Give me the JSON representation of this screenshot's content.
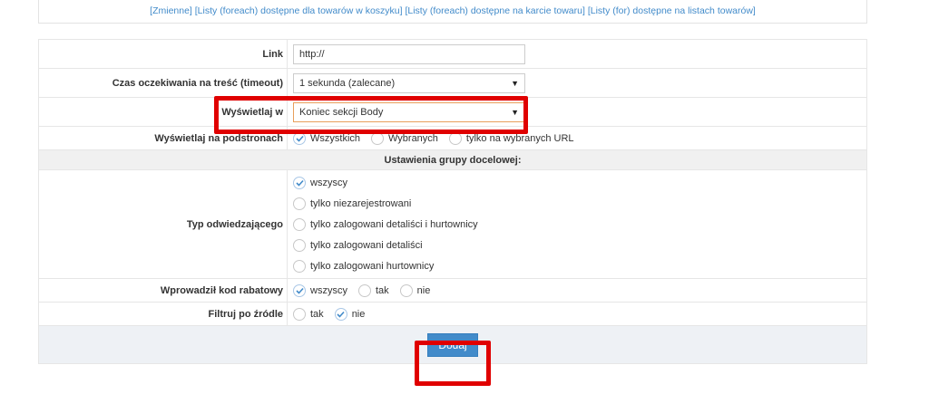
{
  "links_bar": {
    "items": [
      "[Zmienne]",
      "[Listy (foreach) dostępne dla towarów w koszyku]",
      "[Listy (foreach) dostępne na karcie towaru]",
      "[Listy (for) dostępne na listach towarów]"
    ],
    "color": "#428bca"
  },
  "form": {
    "link": {
      "label": "Link",
      "value": "http://"
    },
    "timeout": {
      "label": "Czas oczekiwania na treść (timeout)",
      "selected": "1 sekunda (zalecane)"
    },
    "display_in": {
      "label": "Wyświetlaj w",
      "selected": "Koniec sekcji Body"
    },
    "subpages": {
      "label": "Wyświetlaj na podstronach",
      "options": [
        "Wszystkich",
        "Wybranych",
        "tylko na wybranych URL"
      ],
      "checked_index": 0
    },
    "section_title": "Ustawienia grupy docelowej:",
    "visitor_type": {
      "label": "Typ odwiedzającego",
      "options": [
        "wszyscy",
        "tylko niezarejestrowani",
        "tylko zalogowani detaliści i hurtownicy",
        "tylko zalogowani detaliści",
        "tylko zalogowani hurtownicy"
      ],
      "checked_index": 0
    },
    "discount_code": {
      "label": "Wprowadził kod rabatowy",
      "options": [
        "wszyscy",
        "tak",
        "nie"
      ],
      "checked_index": 0
    },
    "source_filter": {
      "label": "Filtruj po źródle",
      "options": [
        "tak",
        "nie"
      ],
      "checked_index": 1
    },
    "submit_label": "Dodaj"
  },
  "colors": {
    "primary_button": "#428bca",
    "highlight": "#e00000",
    "select_focus_border": "#e8a05c"
  },
  "icons": {
    "select_arrow": "triangle-down-icon",
    "radio_check": "checkmark-icon"
  }
}
